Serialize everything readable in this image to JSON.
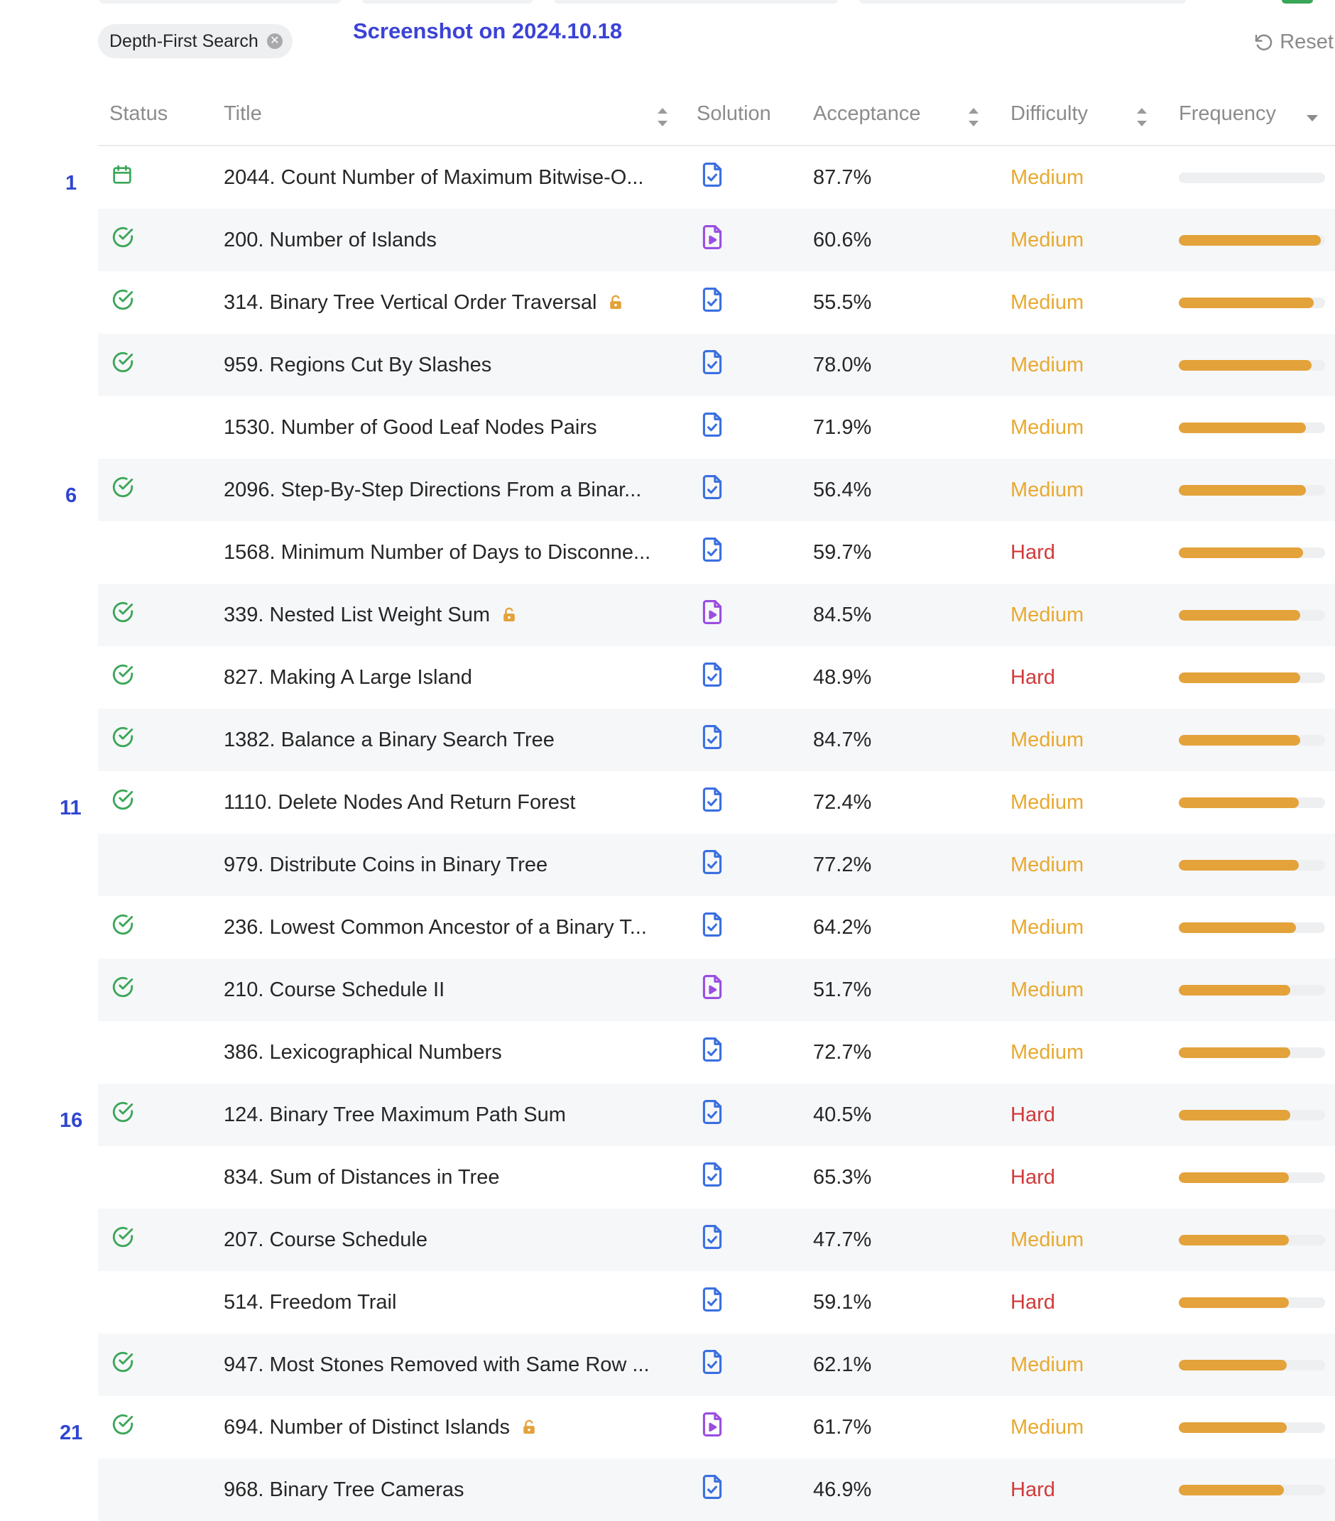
{
  "filter": {
    "chip_label": "Depth-First Search",
    "close_icon": "x-circle-icon"
  },
  "screenshot_label": "Screenshot on 2024.10.18",
  "reset_label": "Reset",
  "columns": {
    "status": "Status",
    "title": "Title",
    "solution": "Solution",
    "acceptance": "Acceptance",
    "difficulty": "Difficulty",
    "frequency": "Frequency"
  },
  "colors": {
    "medium": "#e9a930",
    "hard": "#d13a3a",
    "solved": "#3aa657",
    "article": "#3a6fe0",
    "video": "#9a4ee0",
    "frequency_bar": "#e3a23a",
    "annotation": "#2f45d1"
  },
  "row_numbers": [
    {
      "label": "1",
      "row": 1
    },
    {
      "label": "6",
      "row": 6
    },
    {
      "label": "11",
      "row": 11
    },
    {
      "label": "16",
      "row": 16
    },
    {
      "label": "21",
      "row": 21
    }
  ],
  "rows": [
    {
      "status": "daily",
      "title": "2044. Count Number of Maximum Bitwise-O...",
      "solution": "article",
      "acceptance": "87.7%",
      "difficulty": "Medium",
      "locked": false,
      "frequency": 0.0
    },
    {
      "status": "solved",
      "title": "200. Number of Islands",
      "solution": "video",
      "acceptance": "60.6%",
      "difficulty": "Medium",
      "locked": false,
      "frequency": 0.97
    },
    {
      "status": "solved",
      "title": "314. Binary Tree Vertical Order Traversal",
      "solution": "article",
      "acceptance": "55.5%",
      "difficulty": "Medium",
      "locked": true,
      "frequency": 0.92
    },
    {
      "status": "solved",
      "title": "959. Regions Cut By Slashes",
      "solution": "article",
      "acceptance": "78.0%",
      "difficulty": "Medium",
      "locked": false,
      "frequency": 0.91
    },
    {
      "status": "none",
      "title": "1530. Number of Good Leaf Nodes Pairs",
      "solution": "article",
      "acceptance": "71.9%",
      "difficulty": "Medium",
      "locked": false,
      "frequency": 0.87
    },
    {
      "status": "solved",
      "title": "2096. Step-By-Step Directions From a Binar...",
      "solution": "article",
      "acceptance": "56.4%",
      "difficulty": "Medium",
      "locked": false,
      "frequency": 0.87
    },
    {
      "status": "none",
      "title": "1568. Minimum Number of Days to Disconne...",
      "solution": "article",
      "acceptance": "59.7%",
      "difficulty": "Hard",
      "locked": false,
      "frequency": 0.85
    },
    {
      "status": "solved",
      "title": "339. Nested List Weight Sum",
      "solution": "video",
      "acceptance": "84.5%",
      "difficulty": "Medium",
      "locked": true,
      "frequency": 0.83
    },
    {
      "status": "solved",
      "title": "827. Making A Large Island",
      "solution": "article",
      "acceptance": "48.9%",
      "difficulty": "Hard",
      "locked": false,
      "frequency": 0.83
    },
    {
      "status": "solved",
      "title": "1382. Balance a Binary Search Tree",
      "solution": "article",
      "acceptance": "84.7%",
      "difficulty": "Medium",
      "locked": false,
      "frequency": 0.83
    },
    {
      "status": "solved",
      "title": "1110. Delete Nodes And Return Forest",
      "solution": "article",
      "acceptance": "72.4%",
      "difficulty": "Medium",
      "locked": false,
      "frequency": 0.82
    },
    {
      "status": "none",
      "title": "979. Distribute Coins in Binary Tree",
      "solution": "article",
      "acceptance": "77.2%",
      "difficulty": "Medium",
      "locked": false,
      "frequency": 0.82
    },
    {
      "status": "solved",
      "title": "236. Lowest Common Ancestor of a Binary T...",
      "solution": "article",
      "acceptance": "64.2%",
      "difficulty": "Medium",
      "locked": false,
      "frequency": 0.8
    },
    {
      "status": "solved",
      "title": "210. Course Schedule II",
      "solution": "video",
      "acceptance": "51.7%",
      "difficulty": "Medium",
      "locked": false,
      "frequency": 0.76
    },
    {
      "status": "none",
      "title": "386. Lexicographical Numbers",
      "solution": "article",
      "acceptance": "72.7%",
      "difficulty": "Medium",
      "locked": false,
      "frequency": 0.76
    },
    {
      "status": "solved",
      "title": "124. Binary Tree Maximum Path Sum",
      "solution": "article",
      "acceptance": "40.5%",
      "difficulty": "Hard",
      "locked": false,
      "frequency": 0.76
    },
    {
      "status": "none",
      "title": "834. Sum of Distances in Tree",
      "solution": "article",
      "acceptance": "65.3%",
      "difficulty": "Hard",
      "locked": false,
      "frequency": 0.75
    },
    {
      "status": "solved",
      "title": "207. Course Schedule",
      "solution": "article",
      "acceptance": "47.7%",
      "difficulty": "Medium",
      "locked": false,
      "frequency": 0.75
    },
    {
      "status": "none",
      "title": "514. Freedom Trail",
      "solution": "article",
      "acceptance": "59.1%",
      "difficulty": "Hard",
      "locked": false,
      "frequency": 0.75
    },
    {
      "status": "solved",
      "title": "947. Most Stones Removed with Same Row ...",
      "solution": "article",
      "acceptance": "62.1%",
      "difficulty": "Medium",
      "locked": false,
      "frequency": 0.74
    },
    {
      "status": "solved",
      "title": "694. Number of Distinct Islands",
      "solution": "video",
      "acceptance": "61.7%",
      "difficulty": "Medium",
      "locked": true,
      "frequency": 0.74
    },
    {
      "status": "none",
      "title": "968. Binary Tree Cameras",
      "solution": "article",
      "acceptance": "46.9%",
      "difficulty": "Hard",
      "locked": false,
      "frequency": 0.72
    }
  ]
}
